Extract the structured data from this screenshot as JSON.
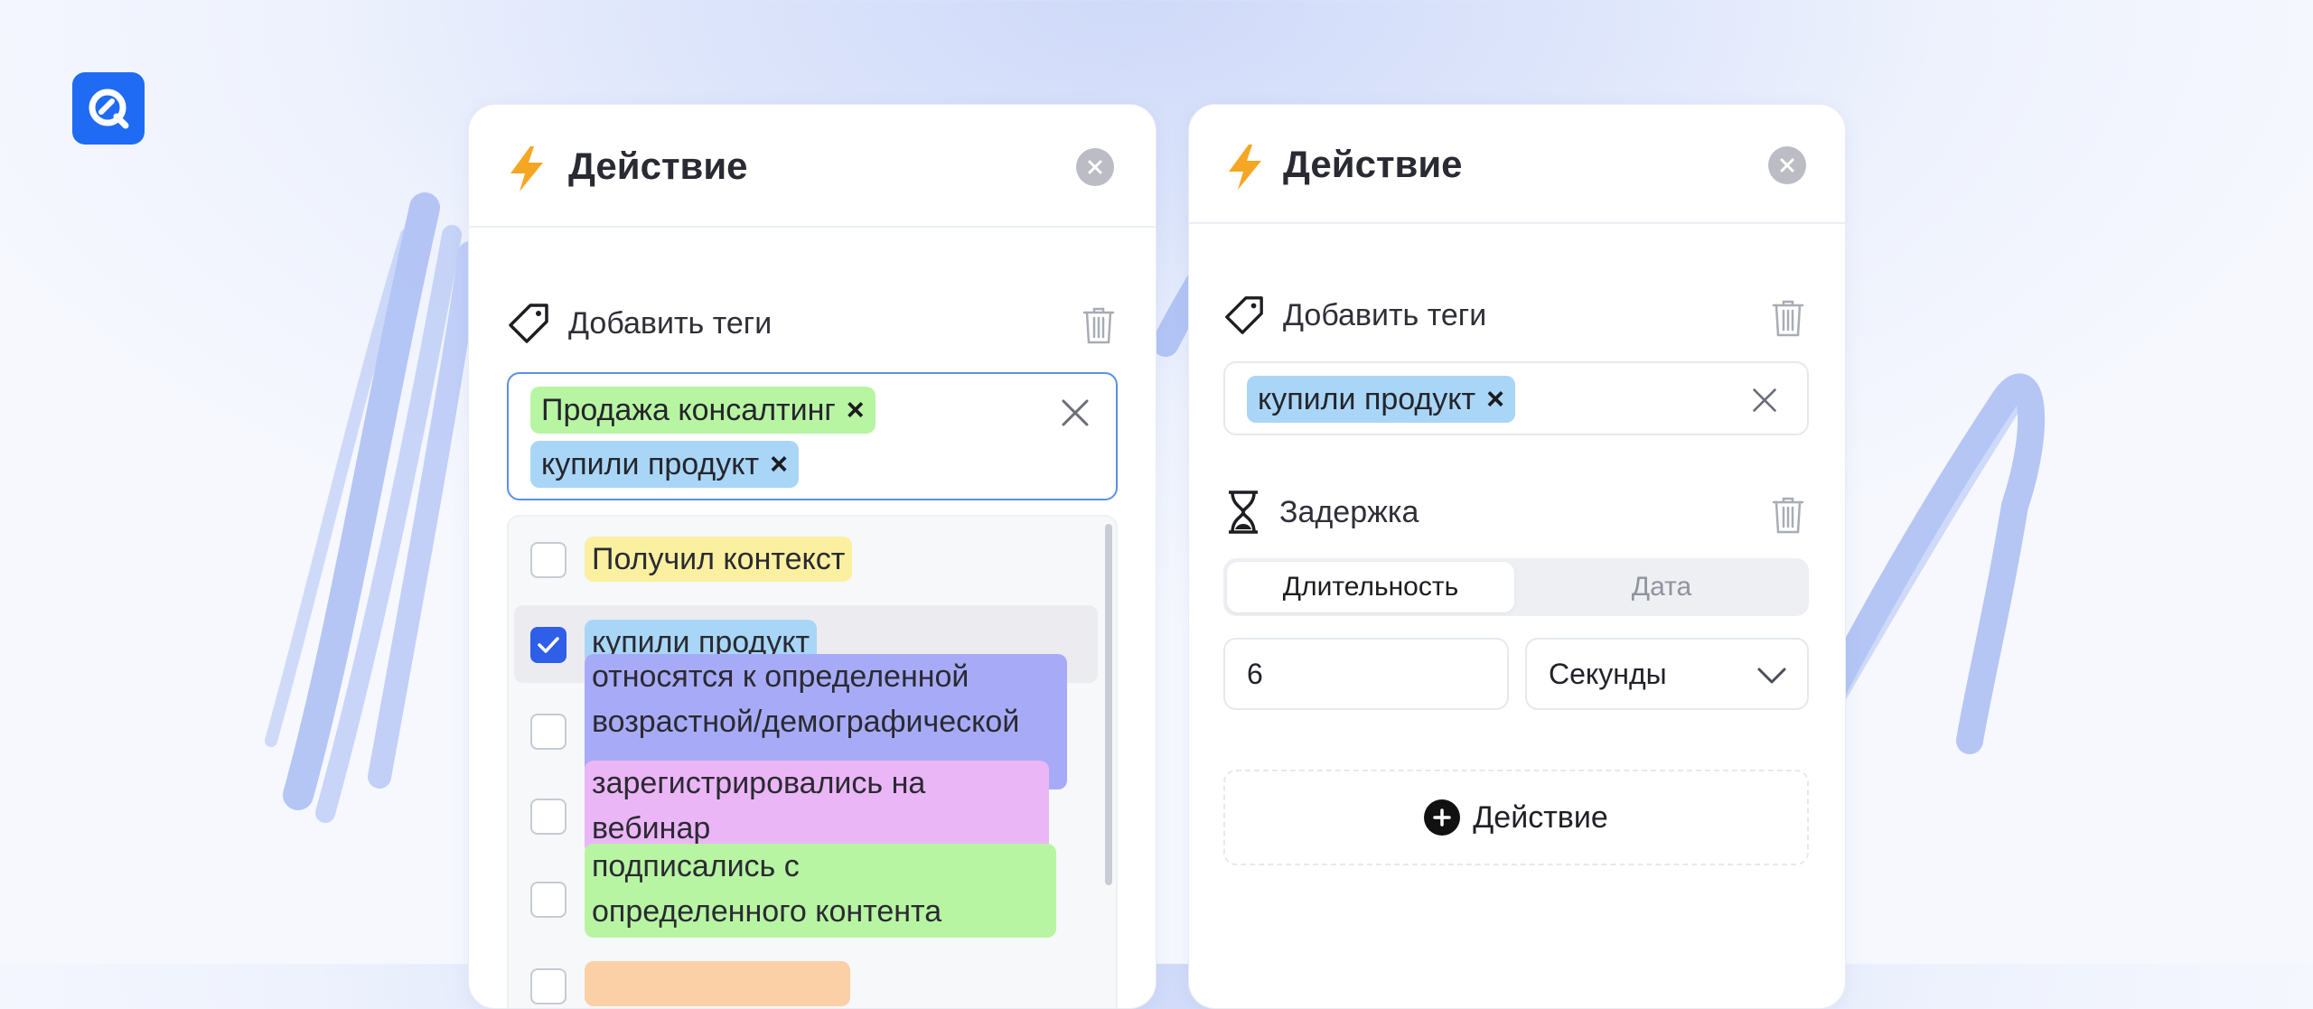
{
  "colors": {
    "accent_blue": "#1f6bf3",
    "bolt": "#f5a623",
    "tag_green": "#b8f5a3",
    "tag_blue": "#a9d6f7",
    "tag_yellow": "#faf0a0",
    "tag_purple": "#a7abf7",
    "tag_pink": "#ebb6f6",
    "tag_orange": "#fbd0a6",
    "checkbox_checked": "#2f5ee8"
  },
  "left_panel": {
    "title": "Действие",
    "icon": "lightning-bolt-icon",
    "add_tags": {
      "label": "Добавить теги",
      "icon": "tag-icon",
      "selected_tags": [
        {
          "label": "Продажа консалтинг",
          "remove": "×",
          "color": "#b8f5a3"
        },
        {
          "label": "купили продукт",
          "remove": "×",
          "color": "#a9d6f7"
        }
      ]
    },
    "dropdown_options": [
      {
        "label": "Получил контекст",
        "checked": false,
        "color": "#faf0a0"
      },
      {
        "label": "купили продукт",
        "checked": true,
        "color": "#a9d6f7"
      },
      {
        "label_line1": "относятся к определенной",
        "label_line2": "возрастной/демографической",
        "checked": false,
        "color": "#a7abf7"
      },
      {
        "label_line1": "зарегистрировались на",
        "label_line2": "вебинар",
        "checked": false,
        "color": "#ebb6f6"
      },
      {
        "label_line1": "подписались с",
        "label_line2": "определенного контента",
        "checked": false,
        "color": "#b8f5a3"
      }
    ]
  },
  "right_panel": {
    "title": "Действие",
    "icon": "lightning-bolt-icon",
    "add_tags": {
      "label": "Добавить теги",
      "icon": "tag-icon",
      "selected_tags": [
        {
          "label": "купили продукт",
          "remove": "×",
          "color": "#a9d6f7"
        }
      ]
    },
    "delay": {
      "label": "Задержка",
      "icon": "hourglass-icon",
      "tabs": [
        "Длительность",
        "Дата"
      ],
      "active_tab": "Длительность",
      "value": "6",
      "unit": "Секунды"
    },
    "add_action_label": "Действие"
  }
}
